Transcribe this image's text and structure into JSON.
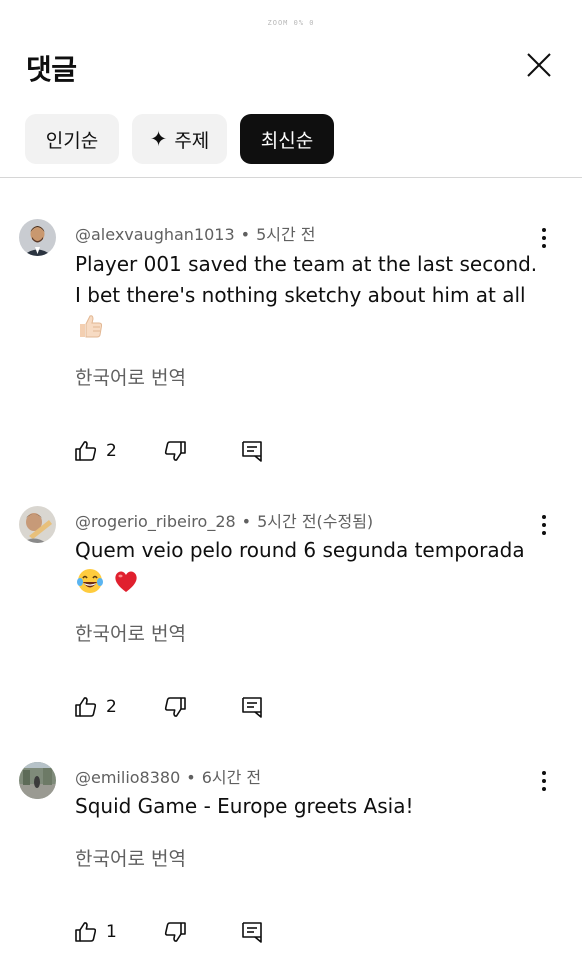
{
  "status_bar": {
    "text": "ZOOM 0% 0"
  },
  "header": {
    "title": "댓글"
  },
  "filters": [
    {
      "label": "인기순",
      "active": false
    },
    {
      "label": "주제",
      "active": false
    },
    {
      "label": "최신순",
      "active": true
    }
  ],
  "comments": [
    {
      "author": "@alexvaughan1013",
      "time": "5시간 전",
      "text": "Player 001 saved the team at the last second. I bet there's nothing sketchy about him at all",
      "emoji": "thumbs-up",
      "translate": "한국어로 번역",
      "likes": "2"
    },
    {
      "author": "@rogerio_ribeiro_28",
      "time": "5시간 전(수정됨)",
      "text": "Quem veio pelo round 6 segunda temporada",
      "emoji": "laugh-heart",
      "translate": "한국어로 번역",
      "likes": "2"
    },
    {
      "author": "@emilio8380",
      "time": "6시간 전",
      "text": "Squid Game - Europe greets Asia!",
      "translate": "한국어로 번역",
      "likes": "1"
    }
  ]
}
